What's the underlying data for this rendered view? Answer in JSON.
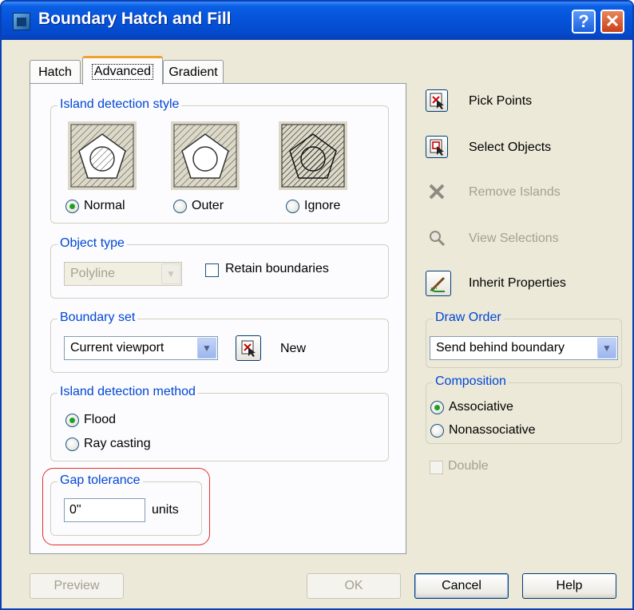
{
  "window": {
    "title": "Boundary Hatch and Fill",
    "help_glyph": "?",
    "close_glyph": "✕",
    "accent": "#0a5fe5",
    "legend_color": "#0046d5"
  },
  "tabs": [
    {
      "label": "Hatch"
    },
    {
      "label": "Advanced"
    },
    {
      "label": "Gradient"
    }
  ],
  "island_style": {
    "legend": "Island detection style",
    "options": [
      {
        "label": "Normal",
        "selected": true
      },
      {
        "label": "Outer",
        "selected": false
      },
      {
        "label": "Ignore",
        "selected": false
      }
    ]
  },
  "object_type": {
    "legend": "Object type",
    "value": "Polyline",
    "retain_label": "Retain boundaries"
  },
  "boundary_set": {
    "legend": "Boundary set",
    "value": "Current viewport",
    "new_label": "New"
  },
  "island_method": {
    "legend": "Island detection method",
    "options": [
      {
        "label": "Flood",
        "selected": true
      },
      {
        "label": "Ray casting",
        "selected": false
      }
    ]
  },
  "gap": {
    "legend": "Gap tolerance",
    "value": "0\"",
    "units": "units"
  },
  "side_buttons": {
    "pick_points": "Pick Points",
    "select_objects": "Select Objects",
    "remove_islands": "Remove Islands",
    "view_selections": "View Selections",
    "inherit_properties": "Inherit Properties"
  },
  "draw_order": {
    "legend": "Draw Order",
    "value": "Send behind boundary"
  },
  "composition": {
    "legend": "Composition",
    "options": [
      {
        "label": "Associative",
        "selected": true
      },
      {
        "label": "Nonassociative",
        "selected": false
      }
    ]
  },
  "double_label": "Double",
  "bottom": {
    "preview": "Preview",
    "ok": "OK",
    "cancel": "Cancel",
    "help": "Help"
  }
}
